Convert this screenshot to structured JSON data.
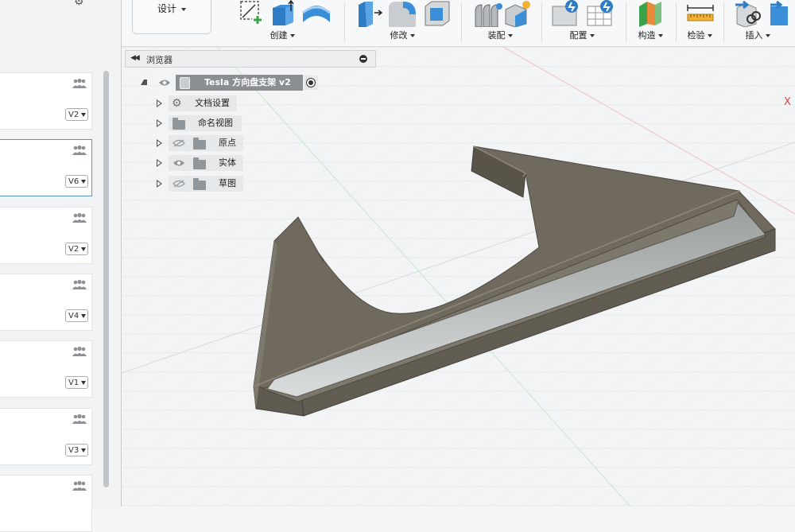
{
  "left_panel": {
    "cards": [
      {
        "version": "V2",
        "selected": false
      },
      {
        "version": "V6",
        "selected": true
      },
      {
        "version": "V2",
        "selected": false
      },
      {
        "version": "V4",
        "selected": false
      },
      {
        "version": "V1",
        "selected": false
      },
      {
        "version": "V3",
        "selected": false
      },
      {
        "version": "",
        "selected": false
      }
    ]
  },
  "toolbar": {
    "workspace": "设计",
    "groups": [
      {
        "label": "创建"
      },
      {
        "label": "修改"
      },
      {
        "label": "装配"
      },
      {
        "label": "配置"
      },
      {
        "label": "构造"
      },
      {
        "label": "检验"
      },
      {
        "label": "插入"
      }
    ]
  },
  "browser": {
    "title": "浏览器",
    "root": {
      "label": "Tesla 方向盘支架 v2"
    },
    "items": [
      {
        "label": "文档设置",
        "icon": "gear-icon"
      },
      {
        "label": "命名视图",
        "icon": "folder-icon"
      },
      {
        "label": "原点",
        "icon": "folder-icon"
      },
      {
        "label": "实体",
        "icon": "folder-icon"
      },
      {
        "label": "草图",
        "icon": "folder-icon"
      }
    ]
  },
  "viewport": {
    "axis_label": "X",
    "model_color": "#6f6a5d"
  }
}
